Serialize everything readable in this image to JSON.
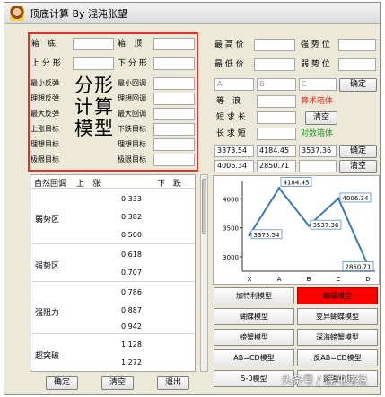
{
  "window": {
    "title": "顶底计算 By 混沌张望",
    "title_extra": "",
    "accent": "#e0312a"
  },
  "left_form": {
    "box": "箱　底",
    "box_top": "箱　顶",
    "up_split": "上 分 形",
    "down_split": "下 分 形",
    "min_rebound": "最小反弹",
    "ideal_rebound": "理想反弹",
    "max_rebound": "最大反弹",
    "rise_target": "上涨目标",
    "ideal_target": "理想目标",
    "limit_target": "极限目标",
    "min_pullback": "最小回调",
    "ideal_pullback": "理想回调",
    "max_pullback": "最大回调",
    "fall_target": "下跌目标",
    "ideal_target2": "理想目标",
    "limit_target2": "极限目标",
    "big_1": "分形",
    "big_2": "计算",
    "big_3": "模型"
  },
  "right_form": {
    "max_price": "最 高 价",
    "min_price": "最 低 价",
    "strong_pos": "强 势 位",
    "weak_pos": "弱 势 位",
    "confirm1": "确定",
    "point_a": "A",
    "point_b": "B",
    "point_c": "C",
    "equal_wave": "等　浪",
    "arith_box": "算术箱体",
    "short_long": "短 求 长",
    "clear1": "清空",
    "long_short": "长 求 短",
    "log_box": "对数箱体",
    "row1": [
      "3373.54",
      "4184.45",
      "3537.36"
    ],
    "confirm2": "确定",
    "row2": [
      "4006.34",
      "2850.71",
      ""
    ],
    "clear2": "清空"
  },
  "list": {
    "headers": [
      "自然回调",
      "上　涨",
      "下　跌"
    ],
    "zones": [
      "弱势区",
      "强势区",
      "强阻力",
      "超突破"
    ],
    "values": [
      "0.333",
      "0.382",
      "0.500",
      "0.618",
      "0.707",
      "0.786",
      "0.887",
      "0.942",
      "1.128",
      "1.272"
    ]
  },
  "bottom_buttons": [
    "确定",
    "清空",
    "退出"
  ],
  "chart_data": {
    "type": "line",
    "categories": [
      "X",
      "A",
      "B",
      "C",
      "D"
    ],
    "values": [
      3373.54,
      4184.45,
      3537.36,
      4006.34,
      2850.71
    ],
    "labels": [
      "3373.54",
      "4184.45",
      "3537.36",
      "4006.34",
      "2850.71"
    ],
    "ylim": [
      2750,
      4300
    ],
    "yticks": [
      3000,
      3500,
      4000
    ],
    "title": "",
    "xlabel": "",
    "ylabel": "",
    "line_color": "#3a78b8"
  },
  "patterns": [
    {
      "label": "加特利模型",
      "active": false
    },
    {
      "label": "蝙蝠模型",
      "active": true
    },
    {
      "label": "蝴蝶模型",
      "active": false
    },
    {
      "label": "变异蝴蝶模型",
      "active": false
    },
    {
      "label": "螃蟹模型",
      "active": false
    },
    {
      "label": "深海螃蟹模型",
      "active": false
    },
    {
      "label": "AB=CD模型",
      "active": false
    },
    {
      "label": "反AB=CD模型",
      "active": false
    },
    {
      "label": "5-0模型",
      "active": false
    },
    {
      "label": "鲨鱼模型",
      "active": false
    }
  ],
  "active_color": "#ff0000",
  "watermark": "头条号 / 混沌财经"
}
